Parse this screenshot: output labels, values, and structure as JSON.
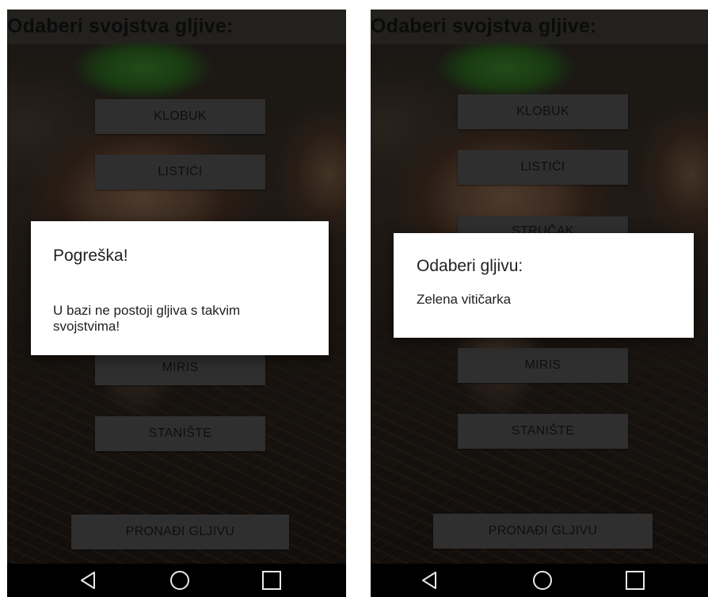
{
  "screens": [
    {
      "title": "Odaberi svojstva gljive:",
      "buttons": {
        "klobuk": "KLOBUK",
        "listici": "LISTIĆI",
        "miris": "MIRIS",
        "staniste": "STANIŠTE",
        "pronadi": "PRONAĐI GLJIVU"
      },
      "dialog": {
        "title": "Pogreška!",
        "message": "U bazi ne postoji gljiva s takvim svojstvima!"
      }
    },
    {
      "title": "Odaberi svojstva gljive:",
      "buttons": {
        "klobuk": "KLOBUK",
        "listici": "LISTIĆI",
        "strucak": "STRUČAK",
        "miris": "MIRIS",
        "staniste": "STANIŠTE",
        "pronadi": "PRONAĐI GLJIVU"
      },
      "dialog": {
        "title": "Odaberi gljivu:",
        "message": "Zelena vitičarka"
      }
    }
  ],
  "navbar": {
    "icons": [
      "back-icon",
      "home-icon",
      "recents-icon"
    ]
  },
  "colors": {
    "button_bg": "#585757",
    "title_bar": "#46423e",
    "dialog_bg": "#ffffff",
    "navbar": "#000000"
  }
}
